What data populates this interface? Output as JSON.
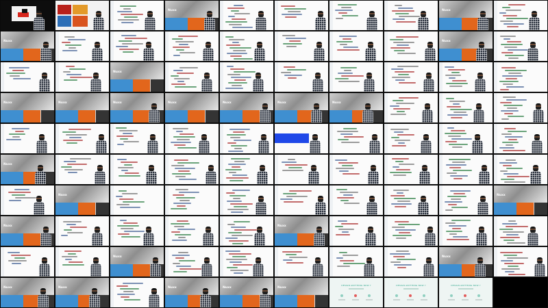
{
  "window": {
    "title": ""
  },
  "contact_sheet": {
    "columns": 10,
    "rows": 10,
    "slide_label": "Nuxx",
    "landing_heading": "DESIGN ANYTHING NOW ?",
    "collage_label": "",
    "frames": [
      {
        "t": "title",
        "p": true
      },
      {
        "t": "collage",
        "p": true
      },
      {
        "t": "code",
        "p": true
      },
      {
        "t": "slide",
        "p": true
      },
      {
        "t": "code",
        "p": true
      },
      {
        "t": "code",
        "p": true
      },
      {
        "t": "code",
        "p": true
      },
      {
        "t": "code",
        "p": true
      },
      {
        "t": "slide",
        "p": true
      },
      {
        "t": "code",
        "p": true
      },
      {
        "t": "slide",
        "p": true
      },
      {
        "t": "code",
        "p": true
      },
      {
        "t": "code",
        "p": true
      },
      {
        "t": "code",
        "p": true
      },
      {
        "t": "code",
        "p": true
      },
      {
        "t": "code",
        "p": true
      },
      {
        "t": "code",
        "p": true
      },
      {
        "t": "code",
        "p": true
      },
      {
        "t": "slide",
        "p": true
      },
      {
        "t": "code",
        "p": true
      },
      {
        "t": "code",
        "p": true
      },
      {
        "t": "code",
        "p": true
      },
      {
        "t": "slide",
        "p": false
      },
      {
        "t": "code",
        "p": true
      },
      {
        "t": "code",
        "p": true
      },
      {
        "t": "code",
        "p": true
      },
      {
        "t": "code",
        "p": true
      },
      {
        "t": "code",
        "p": true
      },
      {
        "t": "code",
        "p": true
      },
      {
        "t": "code",
        "p": false
      },
      {
        "t": "slide",
        "p": false
      },
      {
        "t": "slide",
        "p": false
      },
      {
        "t": "slide",
        "p": true
      },
      {
        "t": "slide",
        "p": false
      },
      {
        "t": "slide",
        "p": true
      },
      {
        "t": "slide",
        "p": true
      },
      {
        "t": "slide",
        "p": true
      },
      {
        "t": "code",
        "p": true
      },
      {
        "t": "code",
        "p": true
      },
      {
        "t": "code",
        "p": true
      },
      {
        "t": "code",
        "p": true
      },
      {
        "t": "code",
        "p": true
      },
      {
        "t": "code",
        "p": true
      },
      {
        "t": "code",
        "p": true
      },
      {
        "t": "code",
        "p": true
      },
      {
        "t": "blue",
        "p": true
      },
      {
        "t": "code",
        "p": true
      },
      {
        "t": "code",
        "p": true
      },
      {
        "t": "code",
        "p": true
      },
      {
        "t": "code",
        "p": true
      },
      {
        "t": "slide",
        "p": true
      },
      {
        "t": "code",
        "p": true
      },
      {
        "t": "code",
        "p": true
      },
      {
        "t": "code",
        "p": true
      },
      {
        "t": "code",
        "p": true
      },
      {
        "t": "code",
        "p": true
      },
      {
        "t": "code",
        "p": true
      },
      {
        "t": "code",
        "p": true
      },
      {
        "t": "code",
        "p": true
      },
      {
        "t": "code",
        "p": true
      },
      {
        "t": "code",
        "p": true
      },
      {
        "t": "slide",
        "p": false
      },
      {
        "t": "code",
        "p": false
      },
      {
        "t": "code",
        "p": false
      },
      {
        "t": "code",
        "p": true
      },
      {
        "t": "code",
        "p": true
      },
      {
        "t": "code",
        "p": true
      },
      {
        "t": "code",
        "p": true
      },
      {
        "t": "code",
        "p": true
      },
      {
        "t": "slide",
        "p": false
      },
      {
        "t": "slide",
        "p": true
      },
      {
        "t": "code",
        "p": true
      },
      {
        "t": "code",
        "p": true
      },
      {
        "t": "code",
        "p": true
      },
      {
        "t": "code",
        "p": true
      },
      {
        "t": "slide",
        "p": true
      },
      {
        "t": "code",
        "p": true
      },
      {
        "t": "code",
        "p": true
      },
      {
        "t": "code",
        "p": true
      },
      {
        "t": "code",
        "p": true
      },
      {
        "t": "code",
        "p": true
      },
      {
        "t": "code",
        "p": true
      },
      {
        "t": "slide",
        "p": true
      },
      {
        "t": "code",
        "p": true
      },
      {
        "t": "code",
        "p": true
      },
      {
        "t": "code",
        "p": true
      },
      {
        "t": "code",
        "p": true
      },
      {
        "t": "code",
        "p": true
      },
      {
        "t": "slide",
        "p": true
      },
      {
        "t": "code",
        "p": true
      },
      {
        "t": "slide",
        "p": true
      },
      {
        "t": "slide",
        "p": true
      },
      {
        "t": "code",
        "p": true
      },
      {
        "t": "slide",
        "p": true
      },
      {
        "t": "slide",
        "p": true
      },
      {
        "t": "slide",
        "p": false
      },
      {
        "t": "landing",
        "p": false
      },
      {
        "t": "landing",
        "p": false
      },
      {
        "t": "landing",
        "p": false
      },
      {
        "t": "black",
        "p": false
      }
    ]
  },
  "colors": {
    "background": "#000000",
    "code_bg": "#fbfbfb",
    "slide_blue": "#3f8fd0",
    "slide_orange": "#e2661c",
    "selection_blue": "#1f48e8",
    "landing_accent": "#2aa58a"
  },
  "icons": {
    "presenter": "person-icon"
  }
}
